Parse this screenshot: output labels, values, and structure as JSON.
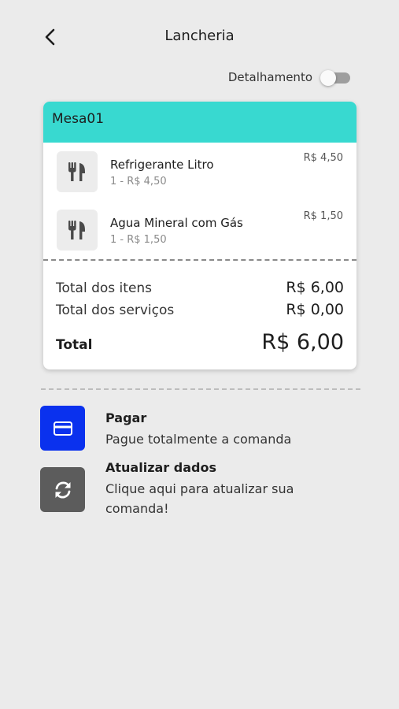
{
  "header": {
    "title": "Lancheria",
    "back_icon": "chevron-left-icon"
  },
  "detail_toggle": {
    "label": "Detalhamento",
    "on": false
  },
  "order": {
    "table_name": "Mesa01",
    "items": [
      {
        "name": "Refrigerante Litro",
        "detail": "1 - R$ 4,50",
        "price": "R$ 4,50",
        "icon": "cutlery-icon"
      },
      {
        "name": "Agua Mineral com Gás",
        "detail": "1 - R$ 1,50",
        "price": "R$ 1,50",
        "icon": "cutlery-icon"
      }
    ],
    "totals": {
      "items_label": "Total dos itens",
      "items_value": "R$ 6,00",
      "services_label": "Total dos serviços",
      "services_value": "R$ 0,00",
      "total_label": "Total",
      "total_value": "R$ 6,00"
    }
  },
  "actions": {
    "pay": {
      "title": "Pagar",
      "description": "Pague totalmente a comanda",
      "icon": "credit-card-icon",
      "color": "#0a31ee"
    },
    "refresh": {
      "title": "Atualizar dados",
      "description": "Clique aqui para atualizar sua comanda!",
      "icon": "refresh-icon",
      "color": "#5c5c5c"
    }
  },
  "colors": {
    "accent": "#38d9d0",
    "background": "#ebebeb"
  }
}
